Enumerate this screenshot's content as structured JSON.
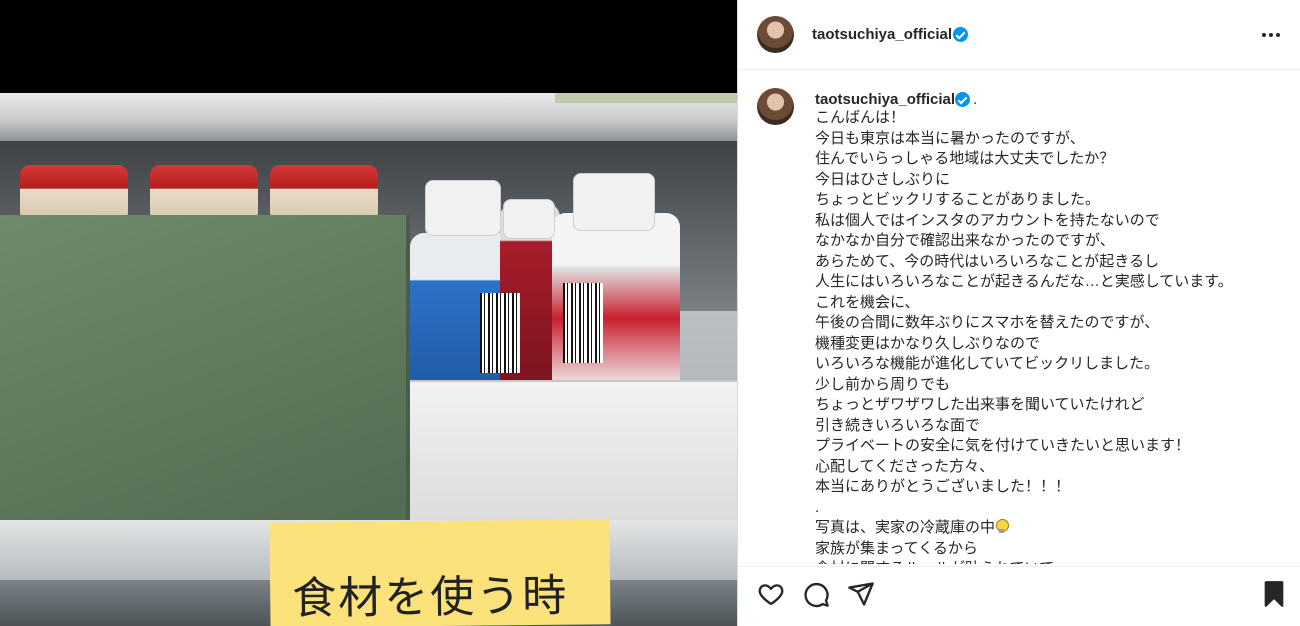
{
  "post": {
    "username": "taotsuchiya_official",
    "caption_username": "taotsuchiya_official",
    "caption_suffix": ".",
    "caption_lines": [
      "こんばんは！",
      "今日も東京は本当に暑かったのですが、",
      "住んでいらっしゃる地域は大丈夫でしたか？",
      "今日はひさしぶりに",
      "ちょっとビックリすることがありました。",
      "私は個人ではインスタのアカウントを持たないので",
      "なかなか自分で確認出来なかったのですが、",
      "あらためて、今の時代はいろいろなことが起きるし",
      "人生にはいろいろなことが起きるんだな…と実感しています。",
      "これを機会に、",
      "午後の合間に数年ぶりにスマホを替えたのですが、",
      "機種変更はかなり久しぶりなので",
      "いろいろな機能が進化していてビックリしました。",
      "少し前から周りでも",
      "ちょっとザワザワした出来事を聞いていたけれど",
      "引き続きいろいろな面で",
      "プライベートの安全に気を付けていきたいと思います！",
      "心配してくださった方々、",
      "本当にありがとうございました！！！",
      ".",
      "写真は、実家の冷蔵庫の中",
      "家族が集まってくるから",
      "食材に関するルールが貼られていて"
    ],
    "caption_emoji_line": 20,
    "photo_note_text": "食材を使う時",
    "icons": {
      "more": "more-options-icon",
      "verified": "verified-badge-icon",
      "like": "heart-icon",
      "comment": "comment-icon",
      "share": "paper-plane-icon",
      "save": "bookmark-icon",
      "emoji": "lightbulb-icon"
    },
    "colors": {
      "verified": "#0095f6",
      "text": "#262626",
      "divider": "#efefef"
    }
  }
}
